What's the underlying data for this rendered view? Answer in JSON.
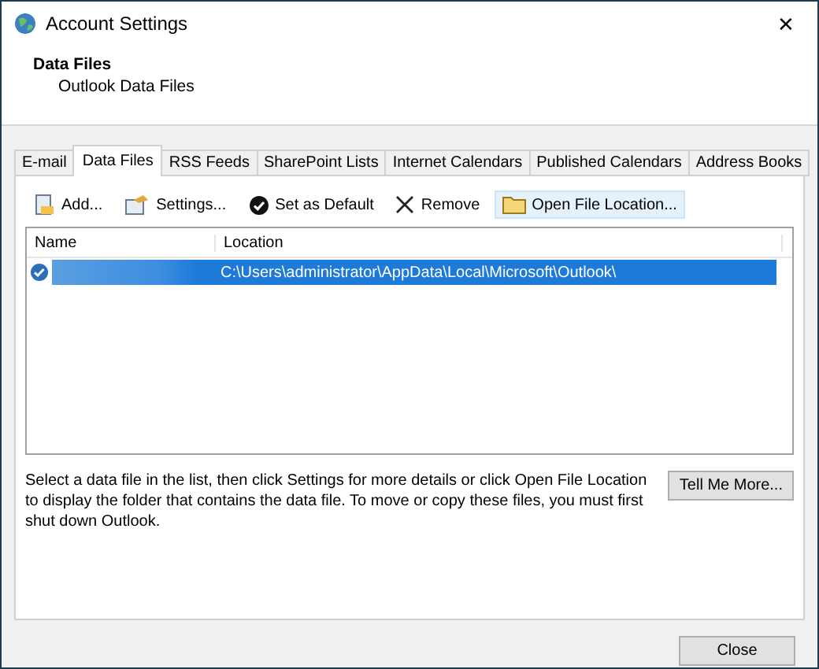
{
  "window": {
    "title": "Account Settings",
    "close": "✕"
  },
  "header": {
    "title": "Data Files",
    "subtitle": "Outlook Data Files"
  },
  "tabs": [
    {
      "label": "E-mail",
      "selected": false
    },
    {
      "label": "Data Files",
      "selected": true
    },
    {
      "label": "RSS Feeds",
      "selected": false
    },
    {
      "label": "SharePoint Lists",
      "selected": false
    },
    {
      "label": "Internet Calendars",
      "selected": false
    },
    {
      "label": "Published Calendars",
      "selected": false
    },
    {
      "label": "Address Books",
      "selected": false
    }
  ],
  "toolbar": [
    {
      "kind": "add",
      "label": "Add...",
      "hover": false
    },
    {
      "kind": "settings",
      "label": "Settings...",
      "hover": false
    },
    {
      "kind": "default",
      "label": "Set as Default",
      "hover": false
    },
    {
      "kind": "remove",
      "label": "Remove",
      "hover": false
    },
    {
      "kind": "folder",
      "label": "Open File Location...",
      "hover": true
    }
  ],
  "table": {
    "columns": [
      "Name",
      "Location"
    ],
    "rows": [
      {
        "location": "C:\\Users\\administrator\\AppData\\Local\\Microsoft\\Outlook\\",
        "default": true,
        "selected": true
      }
    ]
  },
  "description": "Select a data file in the list, then click Settings for more details or click Open File Location to display the folder that contains the data file. To move or copy these files, you must first shut down Outlook.",
  "help_button": "Tell Me More...",
  "close_button": "Close"
}
